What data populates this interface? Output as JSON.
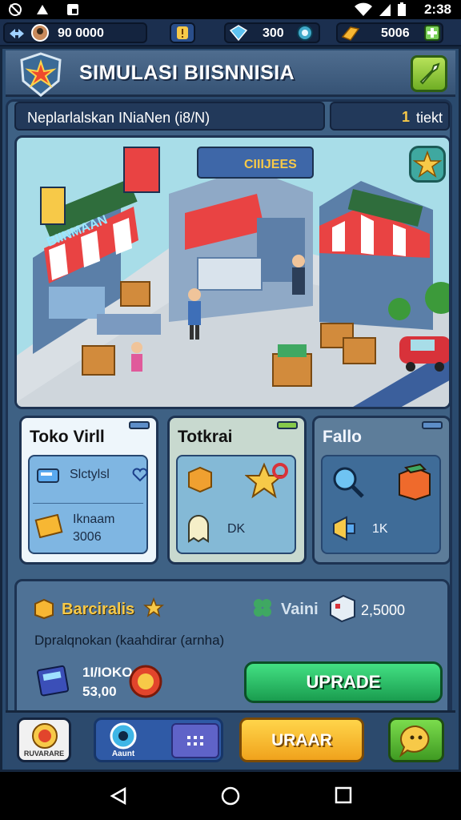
{
  "statusbar": {
    "time": "2:38"
  },
  "hud": {
    "stat1": "90 0000",
    "stat2": "300",
    "stat3": "5006"
  },
  "header": {
    "title": "SIMULASI BIISNNISIA"
  },
  "subheader": {
    "label": "Neplarlalskan INiaNen (i8/N)",
    "counter_value": "1",
    "counter_unit": "tiekt"
  },
  "scene": {
    "signs": [
      "BIINMAAN",
      "CIIIJEES"
    ]
  },
  "cards": [
    {
      "title": "Toko Virll",
      "item1": "Slctylsl",
      "item2_line1": "Iknaam",
      "item2_line2": "3006"
    },
    {
      "title": "Totkrai",
      "item_value": "DK"
    },
    {
      "title": "Fallo",
      "item_value": "1K"
    }
  ],
  "bottom": {
    "title": "Barciralis",
    "vaini": "Vaini",
    "amount": "2,5000",
    "description": "Dpralqnokan (kaahdirar (arnha)",
    "cost_line1": "1I/IOKO",
    "cost_line2": "53,00",
    "upgrade_label": "UPRADE"
  },
  "nav": {
    "shop_label": "RUVARARE",
    "group_label": "Aaunt",
    "main_label": "URAAR"
  },
  "colors": {
    "gold": "#f7c948",
    "upgrade_green": "#1a9d4f",
    "panel_blue": "#3e6184",
    "main_button_orange": "#f0a21c"
  }
}
